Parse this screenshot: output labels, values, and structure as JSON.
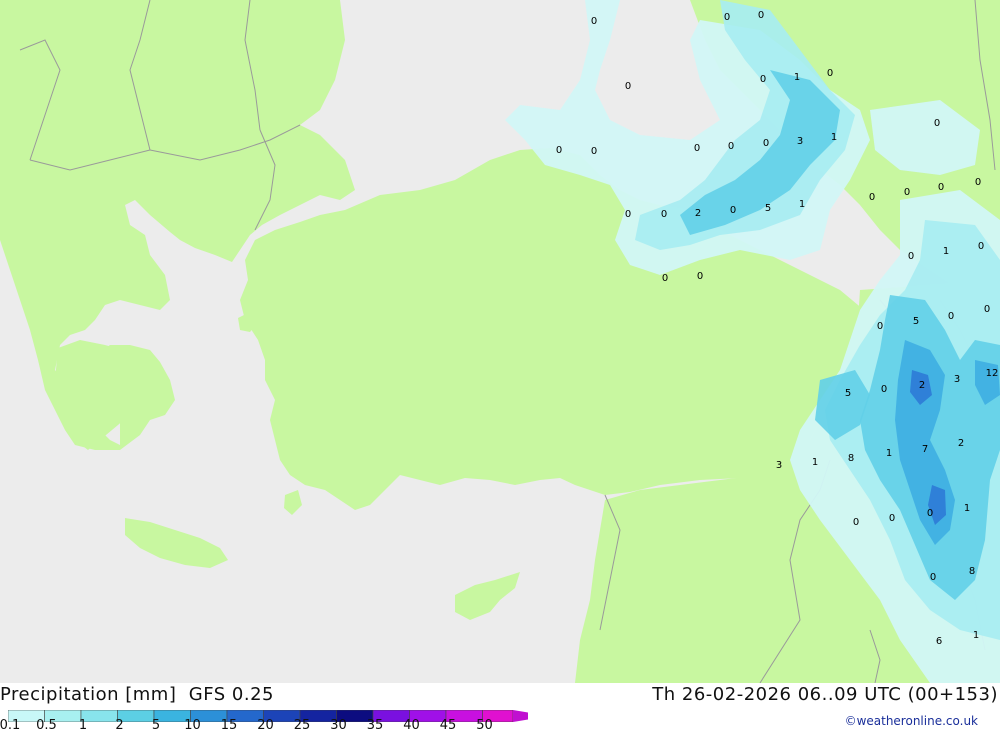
{
  "footer": {
    "title_left": "Precipitation [mm]  GFS 0.25",
    "title_right": "Th 26-02-2026 06..09 UTC (00+153)",
    "credit": "©weatheronline.co.uk"
  },
  "legend": {
    "ticks": [
      "0.1",
      "0.5",
      "1",
      "2",
      "5",
      "10",
      "15",
      "20",
      "25",
      "30",
      "35",
      "40",
      "45",
      "50"
    ],
    "colors": [
      "#c8f8f8",
      "#a8f0f0",
      "#88e4ec",
      "#5ccfe4",
      "#3ab4e0",
      "#2c90d8",
      "#2468cc",
      "#1c44b8",
      "#1424a0",
      "#0c0c80",
      "#7a10e0",
      "#a010e8",
      "#c810e0",
      "#e010d0"
    ]
  },
  "map": {
    "colors": {
      "sea": "#ececec",
      "land": "#c8f7a0",
      "border": "#9a9a9a",
      "precip_light": "#d2f7f7",
      "precip_mid": "#a6ecf2",
      "precip_heavy": "#62cfe8",
      "precip_heavier": "#3eaee2",
      "precip_max": "#2e7ad6"
    },
    "value_labels": [
      "0",
      "0",
      "0",
      "0",
      "1",
      "0",
      "0",
      "0",
      "0",
      "0",
      "0",
      "3",
      "1",
      "0",
      "0",
      "0",
      "0",
      "0",
      "0",
      "0",
      "0",
      "2",
      "0",
      "5",
      "1",
      "0",
      "0",
      "0",
      "1",
      "0",
      "0",
      "0",
      "5",
      "0",
      "5",
      "0",
      "2",
      "3",
      "12",
      "2",
      "7",
      "1",
      "8",
      "1",
      "3",
      "0",
      "0",
      "0",
      "1",
      "0",
      "8",
      "6",
      "1",
      "8",
      "0",
      "0"
    ]
  }
}
